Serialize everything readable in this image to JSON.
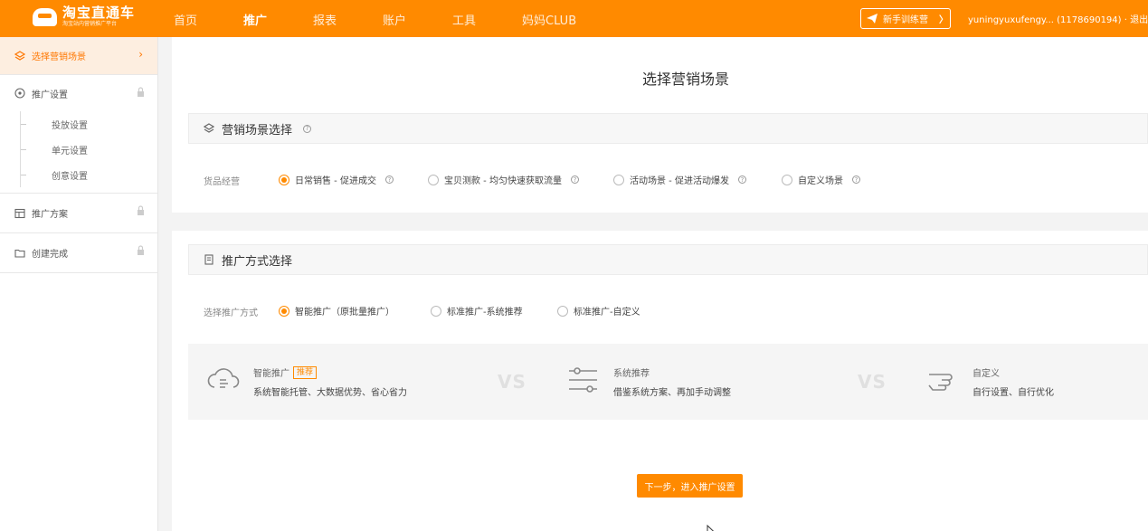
{
  "app": {
    "logo_title": "淘宝直通车",
    "logo_sub": "淘宝站内营销推广平台"
  },
  "nav": [
    {
      "label": "首页",
      "active": false
    },
    {
      "label": "推广",
      "active": true
    },
    {
      "label": "报表",
      "active": false
    },
    {
      "label": "账户",
      "active": false
    },
    {
      "label": "工具",
      "active": false
    },
    {
      "label": "妈妈CLUB",
      "active": false
    }
  ],
  "header": {
    "newbie_label": "新手训练营",
    "user_label": "yuningyuxufengy... (1178690194) · 退出"
  },
  "sidebar": {
    "items": [
      {
        "label": "选择营销场景",
        "active": true
      },
      {
        "label": "推广设置",
        "locked": true
      },
      {
        "label": "推广方案",
        "locked": true
      },
      {
        "label": "创建完成",
        "locked": true
      }
    ],
    "sub_items": [
      "投放设置",
      "单元设置",
      "创意设置"
    ]
  },
  "main": {
    "page_title": "选择营销场景",
    "scene_section": {
      "title": "营销场景选择",
      "row_label": "货品经营",
      "options": [
        {
          "label": "日常销售 - 促进成交",
          "selected": true
        },
        {
          "label": "宝贝测款 - 均匀快速获取流量",
          "selected": false
        },
        {
          "label": "活动场景 - 促进活动爆发",
          "selected": false
        },
        {
          "label": "自定义场景",
          "selected": false
        }
      ]
    },
    "method_section": {
      "title": "推广方式选择",
      "row_label": "选择推广方式",
      "options": [
        {
          "label": "智能推广（原批量推广）",
          "selected": true
        },
        {
          "label": "标准推广-系统推荐",
          "selected": false
        },
        {
          "label": "标准推广-自定义",
          "selected": false
        }
      ]
    },
    "compare": {
      "vs_label": "VS",
      "items": [
        {
          "title": "智能推广",
          "badge": "推荐",
          "desc": "系统智能托管、大数据优势、省心省力"
        },
        {
          "title": "系统推荐",
          "desc": "借鉴系统方案、再加手动调整"
        },
        {
          "title": "自定义",
          "desc": "自行设置、自行优化"
        }
      ]
    },
    "next_button": "下一步，进入推广设置"
  },
  "colors": {
    "brand": "#ff8a00",
    "active_bg": "#fdeee0"
  }
}
